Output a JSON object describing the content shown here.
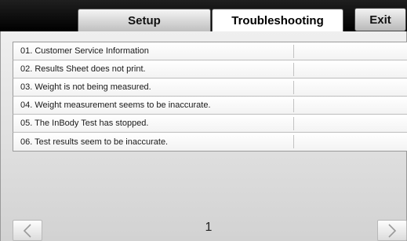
{
  "header": {
    "tabs": [
      {
        "label": "Setup",
        "active": false
      },
      {
        "label": "Troubleshooting",
        "active": true
      }
    ],
    "exit_label": "Exit"
  },
  "troubleshooting": {
    "items": [
      {
        "label": "01. Customer Service Information"
      },
      {
        "label": "02. Results Sheet does not print."
      },
      {
        "label": "03. Weight is not being measured."
      },
      {
        "label": "04. Weight measurement seems to be inaccurate."
      },
      {
        "label": "05. The InBody Test has stopped."
      },
      {
        "label": "06. Test results seem to be inaccurate."
      }
    ]
  },
  "pagination": {
    "current_page": "1",
    "prev_icon": "chevron-left-icon",
    "next_icon": "chevron-right-icon"
  },
  "colors": {
    "header_bg": "#000000",
    "content_bg": "#e4e4e4",
    "row_bg": "#ffffff"
  }
}
